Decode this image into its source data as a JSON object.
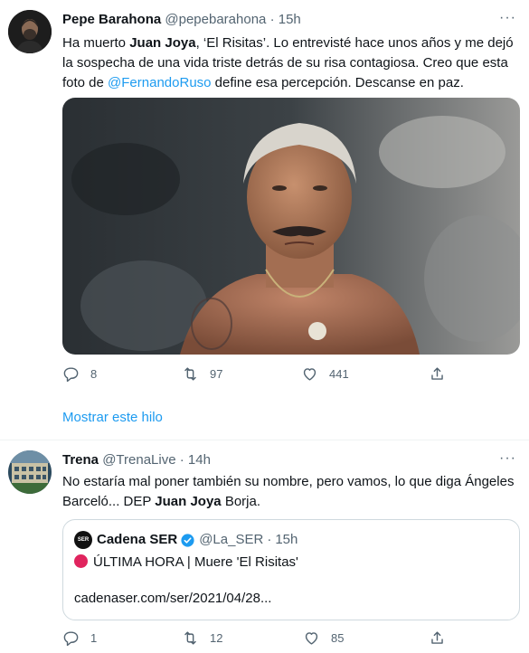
{
  "tweets": [
    {
      "name": "Pepe Barahona",
      "handle": "@pepebarahona",
      "separator": "·",
      "time": "15h",
      "text_parts": {
        "p1": "Ha muerto ",
        "bold1": "Juan Joya",
        "p2": ", ‘El Risitas’. Lo entrevisté hace unos años y me dejó la sospecha de una vida triste detrás de su risa contagiosa. Creo que esta foto de ",
        "mention": "@FernandoRuso",
        "p3": " define esa percepción. Descanse en paz."
      },
      "replies": "8",
      "retweets": "97",
      "likes": "441",
      "show_thread": "Mostrar este hilo"
    },
    {
      "name": "Trena",
      "handle": "@TrenaLive",
      "separator": "·",
      "time": "14h",
      "text_parts": {
        "p1": "No estaría mal poner también su nombre, pero vamos, lo que diga Ángeles Barceló... DEP ",
        "bold1": "Juan Joya",
        "p2": " Borja."
      },
      "quote": {
        "avatar_text": "SER",
        "name": "Cadena SER",
        "handle": "@La_SER",
        "separator": "·",
        "time": "15h",
        "line1": "ÚLTIMA HORA | Muere 'El Risitas'",
        "line2": "cadenaser.com/ser/2021/04/28..."
      },
      "replies": "1",
      "retweets": "12",
      "likes": "85"
    }
  ],
  "more_label": "···",
  "icons": [
    "reply-icon",
    "retweet-icon",
    "like-icon",
    "share-icon",
    "verified-icon",
    "more-icon"
  ],
  "colors": {
    "link": "#1d9bf0",
    "muted": "#536471",
    "text": "#0f1419",
    "border": "#cfd9de",
    "breaking": "#e0245e"
  }
}
